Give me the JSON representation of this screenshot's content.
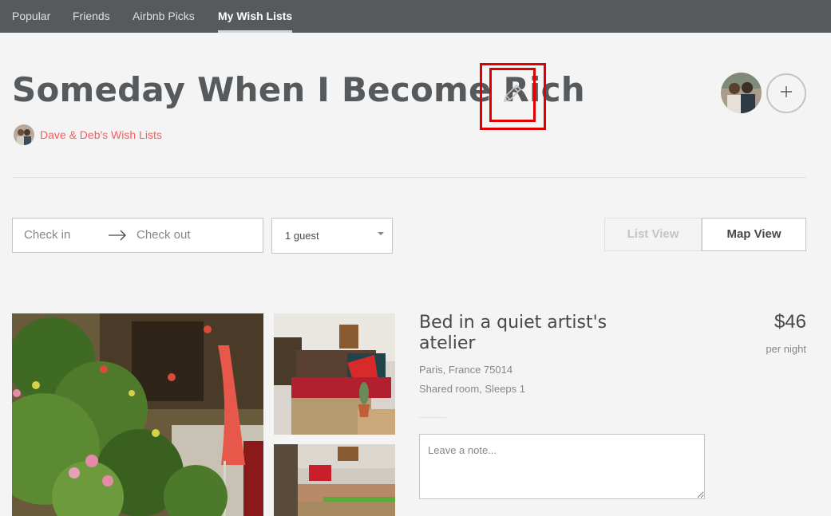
{
  "nav": {
    "tabs": [
      {
        "label": "Popular",
        "active": false
      },
      {
        "label": "Friends",
        "active": false
      },
      {
        "label": "Airbnb Picks",
        "active": false
      },
      {
        "label": "My Wish Lists",
        "active": true
      }
    ]
  },
  "wishlist": {
    "title": "Someday When I Become Rich",
    "owner_label": "Dave & Deb's Wish Lists",
    "edit_icon": "pencil-icon",
    "add_icon": "plus-icon"
  },
  "search": {
    "checkin_placeholder": "Check in",
    "checkout_placeholder": "Check out",
    "guests_value": "1 guest"
  },
  "view_toggle": {
    "list_label": "List View",
    "map_label": "Map View"
  },
  "listing": {
    "title": "Bed in a quiet artist's atelier",
    "location": "Paris, France 75014",
    "room_info": "Shared room, Sleeps 1",
    "price": "$46",
    "price_unit": "per night",
    "note_placeholder": "Leave a note..."
  },
  "colors": {
    "nav_bg": "#565a5c",
    "accent": "#ff5a5f",
    "highlight": "#e00000"
  }
}
